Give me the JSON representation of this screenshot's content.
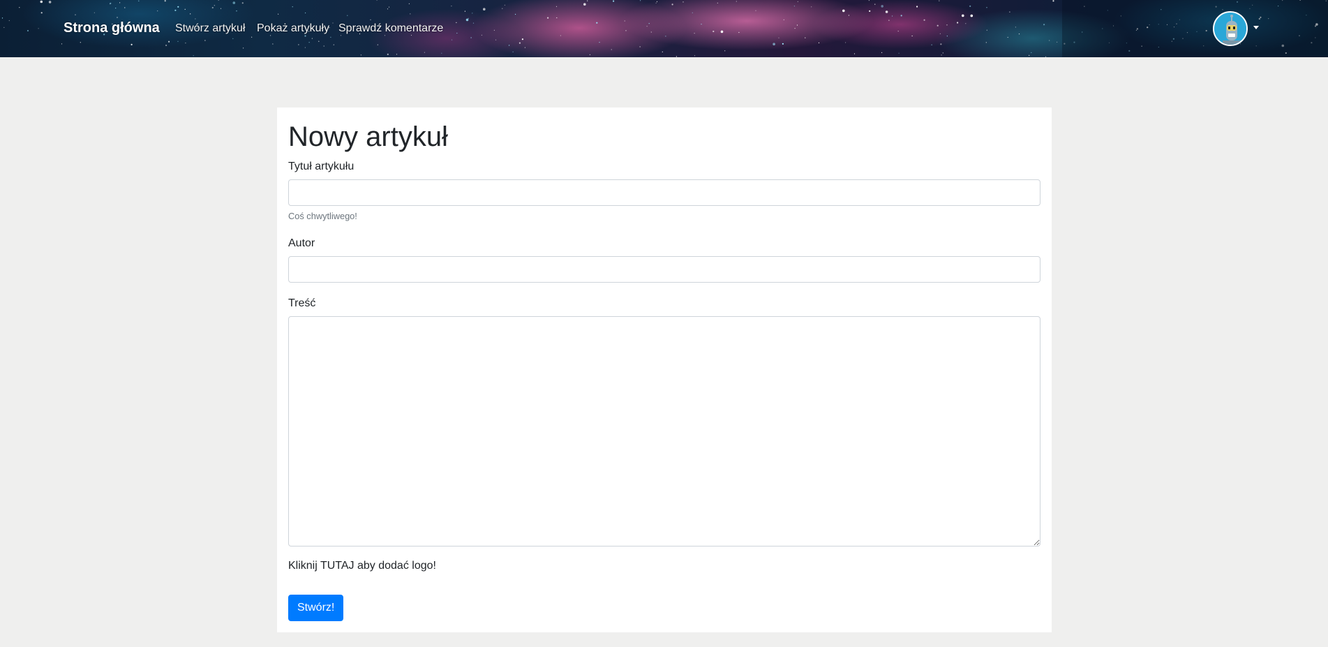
{
  "navbar": {
    "brand": "Strona główna",
    "links": [
      {
        "label": "Stwórz artykuł"
      },
      {
        "label": "Pokaż artykuły"
      },
      {
        "label": "Sprawdź komentarze"
      }
    ],
    "avatar_icon": "robot-avatar-icon"
  },
  "form": {
    "title": "Nowy artykuł",
    "title_label": "Tytuł artykułu",
    "title_value": "",
    "title_help": "Coś chwytliwego!",
    "author_label": "Autor",
    "author_value": "",
    "content_label": "Treść",
    "content_value": "",
    "logo_link": "Kliknij TUTAJ aby dodać logo!",
    "submit_label": "Stwórz!"
  },
  "colors": {
    "primary": "#007bff",
    "page_background": "#efefee",
    "card_background": "#ffffff",
    "help_text": "#6c757d"
  }
}
